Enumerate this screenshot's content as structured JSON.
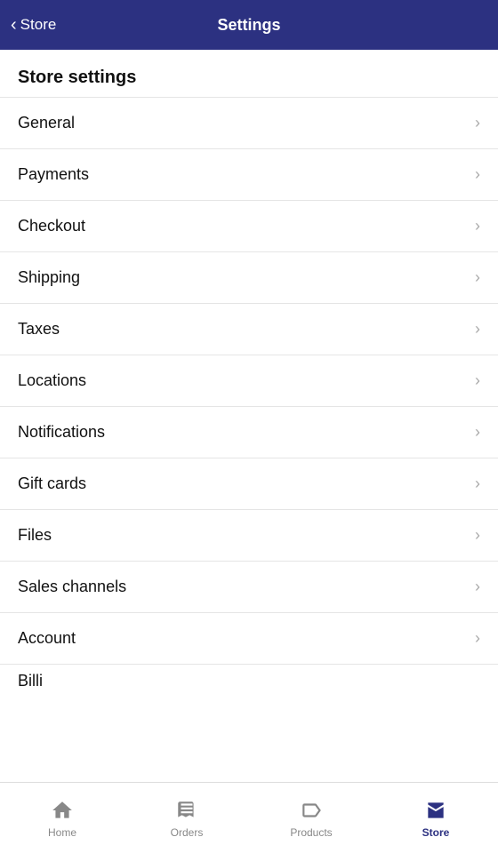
{
  "header": {
    "back_label": "Store",
    "title": "Settings"
  },
  "section": {
    "title": "Store settings"
  },
  "menu_items": [
    {
      "id": "general",
      "label": "General"
    },
    {
      "id": "payments",
      "label": "Payments"
    },
    {
      "id": "checkout",
      "label": "Checkout"
    },
    {
      "id": "shipping",
      "label": "Shipping"
    },
    {
      "id": "taxes",
      "label": "Taxes"
    },
    {
      "id": "locations",
      "label": "Locations"
    },
    {
      "id": "notifications",
      "label": "Notifications"
    },
    {
      "id": "gift-cards",
      "label": "Gift cards"
    },
    {
      "id": "files",
      "label": "Files"
    },
    {
      "id": "sales-channels",
      "label": "Sales channels"
    },
    {
      "id": "account",
      "label": "Account"
    },
    {
      "id": "billing",
      "label": "Billi"
    }
  ],
  "bottom_nav": {
    "items": [
      {
        "id": "home",
        "label": "Home",
        "active": false
      },
      {
        "id": "orders",
        "label": "Orders",
        "active": false
      },
      {
        "id": "products",
        "label": "Products",
        "active": false
      },
      {
        "id": "store",
        "label": "Store",
        "active": true
      }
    ]
  },
  "colors": {
    "accent": "#2c3181",
    "divider": "#e5e5e5",
    "chevron": "#aaa",
    "text_primary": "#111",
    "text_nav": "#888"
  }
}
